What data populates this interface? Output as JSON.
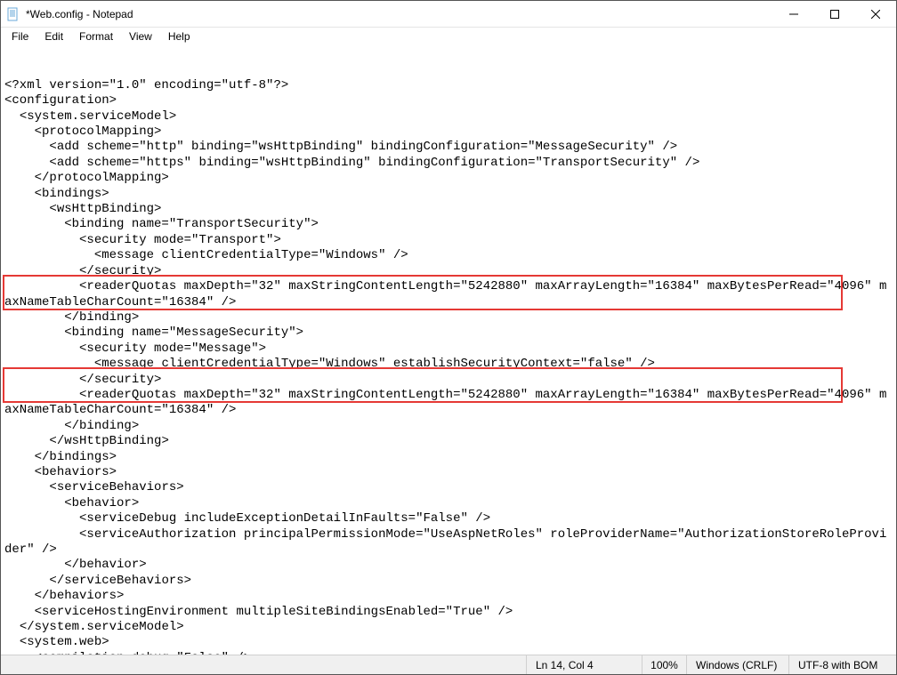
{
  "window": {
    "title": "*Web.config - Notepad"
  },
  "menu": {
    "file": "File",
    "edit": "Edit",
    "format": "Format",
    "view": "View",
    "help": "Help"
  },
  "status": {
    "position": "Ln 14, Col 4",
    "zoom": "100%",
    "eol": "Windows (CRLF)",
    "encoding": "UTF-8 with BOM"
  },
  "editor": {
    "content": "<?xml version=\"1.0\" encoding=\"utf-8\"?>\n<configuration>\n  <system.serviceModel>\n    <protocolMapping>\n      <add scheme=\"http\" binding=\"wsHttpBinding\" bindingConfiguration=\"MessageSecurity\" />\n      <add scheme=\"https\" binding=\"wsHttpBinding\" bindingConfiguration=\"TransportSecurity\" />\n    </protocolMapping>\n    <bindings>\n      <wsHttpBinding>\n        <binding name=\"TransportSecurity\">\n          <security mode=\"Transport\">\n            <message clientCredentialType=\"Windows\" />\n          </security>\n          <readerQuotas maxDepth=\"32\" maxStringContentLength=\"5242880\" maxArrayLength=\"16384\" maxBytesPerRead=\"4096\" maxNameTableCharCount=\"16384\" />\n        </binding>\n        <binding name=\"MessageSecurity\">\n          <security mode=\"Message\">\n            <message clientCredentialType=\"Windows\" establishSecurityContext=\"false\" />\n          </security>\n          <readerQuotas maxDepth=\"32\" maxStringContentLength=\"5242880\" maxArrayLength=\"16384\" maxBytesPerRead=\"4096\" maxNameTableCharCount=\"16384\" />\n        </binding>\n      </wsHttpBinding>\n    </bindings>\n    <behaviors>\n      <serviceBehaviors>\n        <behavior>\n          <serviceDebug includeExceptionDetailInFaults=\"False\" />\n          <serviceAuthorization principalPermissionMode=\"UseAspNetRoles\" roleProviderName=\"AuthorizationStoreRoleProvider\" />\n        </behavior>\n      </serviceBehaviors>\n    </behaviors>\n    <serviceHostingEnvironment multipleSiteBindingsEnabled=\"True\" />\n  </system.serviceModel>\n  <system.web>\n    <compilation debug=\"False\" />"
  }
}
